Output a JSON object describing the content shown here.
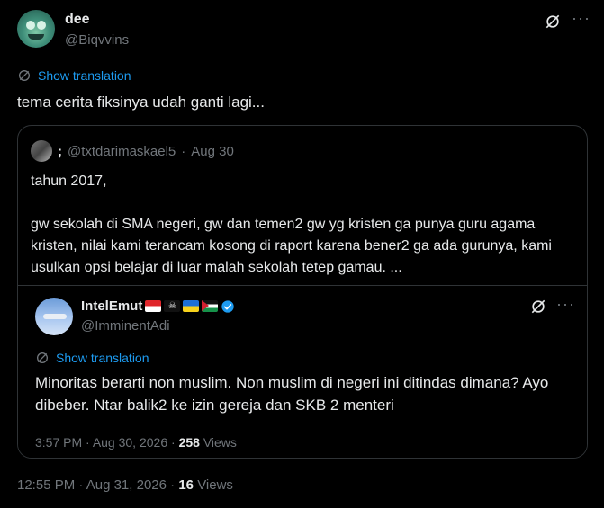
{
  "tweet": {
    "author_name": "dee",
    "author_handle": "@Biqvvins",
    "show_translation": "Show translation",
    "text": "tema cerita fiksinya udah ganti lagi...",
    "meta": {
      "time": "12:55 PM",
      "date": "Aug 31, 2026",
      "views_count": "16",
      "views_label": "Views"
    }
  },
  "quote": {
    "author_name": ";",
    "author_handle": "@txtdarimaskael5",
    "date": "Aug 30",
    "paragraphs": [
      "tahun 2017,",
      "gw sekolah di SMA negeri, gw dan temen2 gw yg kristen ga punya guru agama kristen, nilai kami terancam kosong di raport karena bener2 ga ada gurunya, kami usulkan opsi belajar di luar malah sekolah tetep gamau. ..."
    ]
  },
  "inner_tweet": {
    "author_name": "IntelEmut",
    "author_handle": "@ImminentAdi",
    "show_translation": "Show translation",
    "text": "Minoritas berarti non muslim. Non muslim di negeri ini ditindas dimana? Ayo dibeber. Ntar balik2 ke izin gereja dan SKB 2 menteri",
    "meta": {
      "time": "3:57 PM",
      "date": "Aug 30, 2026",
      "views_count": "258",
      "views_label": "Views"
    }
  },
  "icons": {
    "grok": "grok-icon",
    "more": "more-icon",
    "translate": "globe-icon",
    "verified": "verified-badge-icon"
  },
  "colors": {
    "background": "#000000",
    "text": "#e7e9ea",
    "muted": "#71767b",
    "accent": "#1d9bf0",
    "border": "#2f3336"
  }
}
